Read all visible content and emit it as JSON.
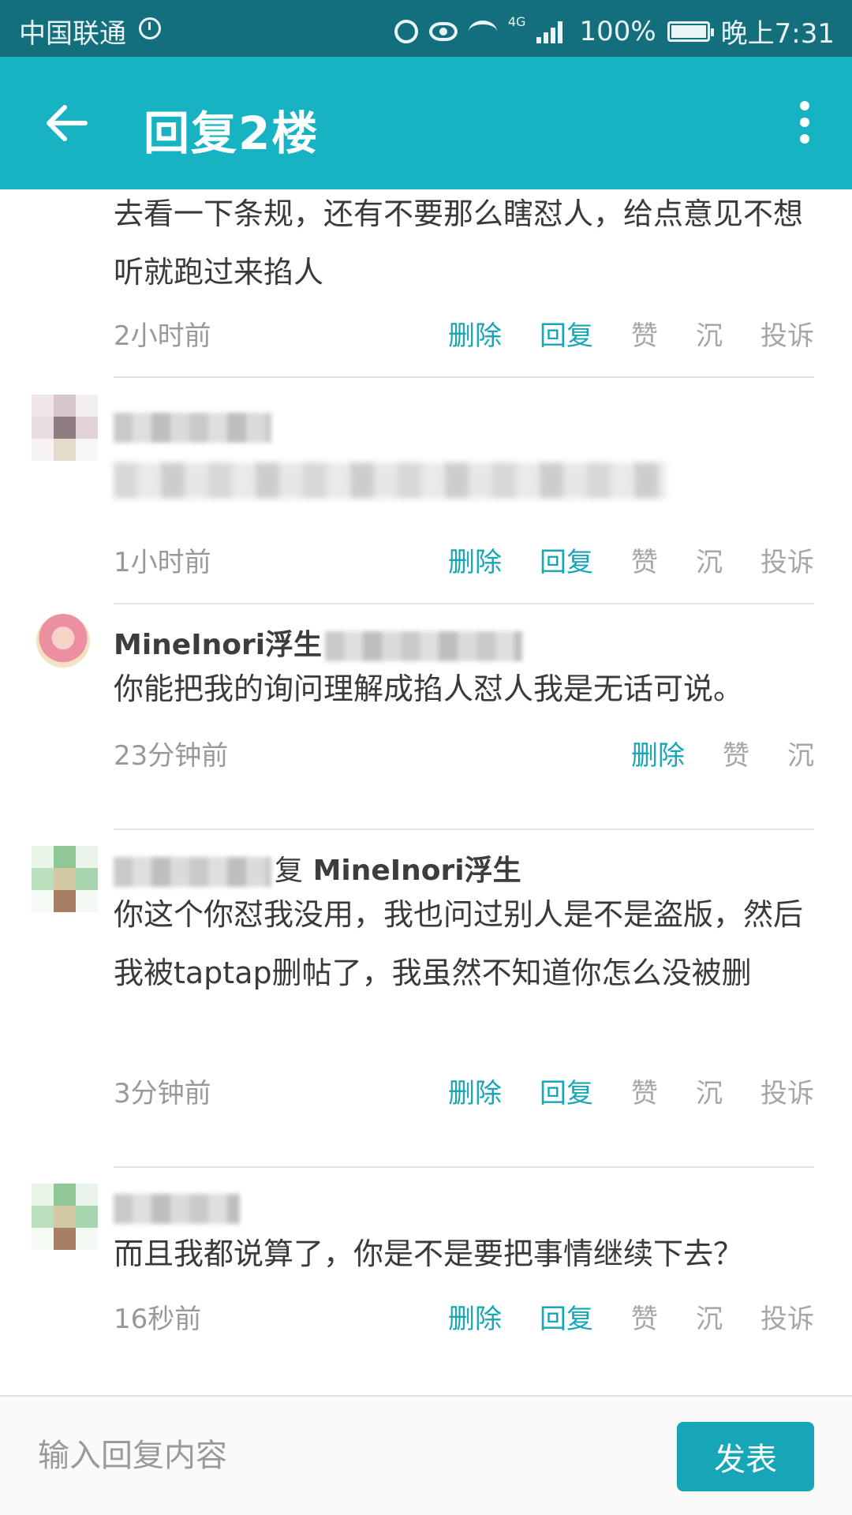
{
  "status_bar": {
    "carrier": "中国联通",
    "network": "4G",
    "battery": "100%",
    "time": "晚上7:31"
  },
  "header": {
    "title": "回复2楼"
  },
  "comments": [
    {
      "text": "去看一下条规，还有不要那么瞎怼人，给点意见不想听就跑过来掐人",
      "time": "2小时前",
      "actions": [
        "删除",
        "回复",
        "赞",
        "沉",
        "投诉"
      ]
    },
    {
      "author": "",
      "text": "",
      "time": "1小时前",
      "actions": [
        "删除",
        "回复",
        "赞",
        "沉",
        "投诉"
      ]
    },
    {
      "author": "MineInori浮生",
      "text": "你能把我的询问理解成掐人怼人我是无话可说。",
      "time": "23分钟前",
      "actions": [
        "删除",
        "赞",
        "沉"
      ]
    },
    {
      "author_suffix": "复",
      "reply_to": "MineInori浮生",
      "text": "你这个你怼我没用，我也问过别人是不是盗版，然后我被taptap删帖了，我虽然不知道你怎么没被删",
      "time": "3分钟前",
      "actions": [
        "删除",
        "回复",
        "赞",
        "沉",
        "投诉"
      ]
    },
    {
      "author": "",
      "text": "而且我都说算了，你是不是要把事情继续下去？",
      "time": "16秒前",
      "actions": [
        "删除",
        "回复",
        "赞",
        "沉",
        "投诉"
      ]
    }
  ],
  "reply_box": {
    "placeholder": "输入回复内容",
    "send_label": "发表"
  },
  "colors": {
    "status_bar": "#136f7c",
    "app_bar": "#17b3c3",
    "accent": "#17a6b8"
  }
}
